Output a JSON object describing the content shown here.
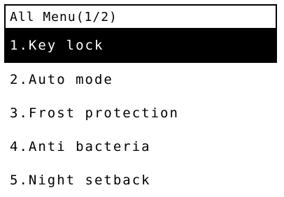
{
  "header": {
    "title": "All Menu(1/2)"
  },
  "menu": {
    "items": [
      {
        "number": "1.",
        "label": "Key lock",
        "selected": true
      },
      {
        "number": "2.",
        "label": "Auto mode",
        "selected": false
      },
      {
        "number": "3.",
        "label": "Frost protection",
        "selected": false
      },
      {
        "number": "4.",
        "label": "Anti bacteria",
        "selected": false
      },
      {
        "number": "5.",
        "label": "Night setback",
        "selected": false
      }
    ]
  },
  "colors": {
    "background": "#ffffff",
    "text": "#000000",
    "selected_background": "#000000",
    "selected_text": "#ffffff"
  }
}
